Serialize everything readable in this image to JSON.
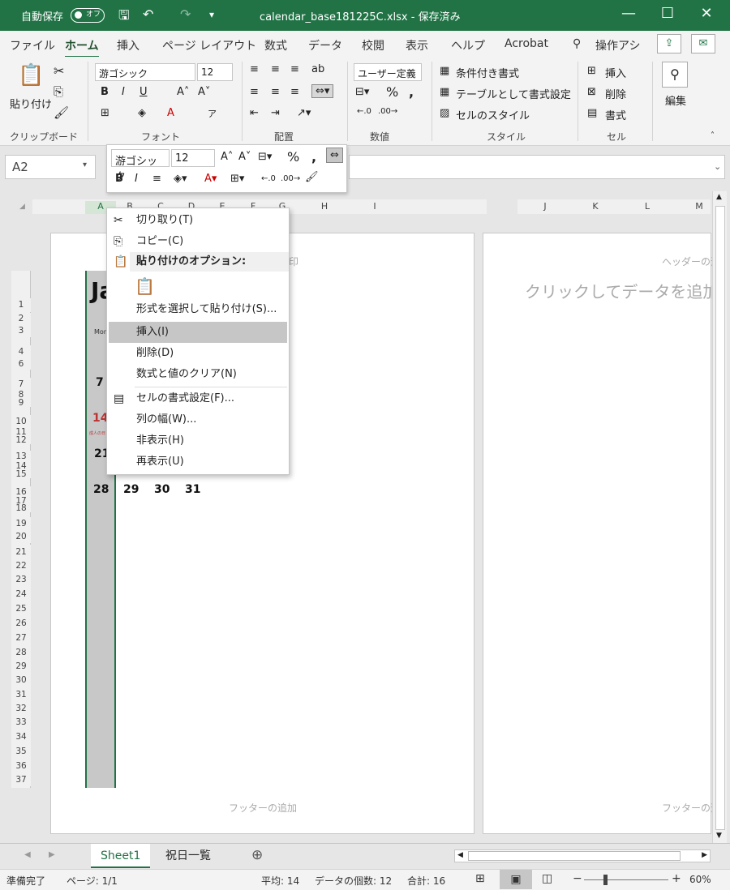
{
  "titlebar": {
    "autosave_label": "自動保存",
    "autosave_state": "オフ",
    "title": "calendar_base181225C.xlsx - 保存済み",
    "minimize": "—",
    "maximize": "☐",
    "close": "✕"
  },
  "tabs": [
    "ファイル",
    "ホーム",
    "挿入",
    "ページ レイアウト",
    "数式",
    "データ",
    "校閲",
    "表示",
    "ヘルプ",
    "Acrobat",
    "操作アシ"
  ],
  "ribbon": {
    "clipboard": {
      "paste": "貼り付け",
      "label": "クリップボード"
    },
    "font": {
      "name": "游ゴシック",
      "size": "12",
      "label": "フォント"
    },
    "alignment": {
      "label": "配置"
    },
    "number": {
      "format": "ユーザー定義",
      "label": "数値"
    },
    "styles": {
      "conditional": "条件付き書式",
      "table": "テーブルとして書式設定",
      "cell": "セルのスタイル",
      "label": "スタイル"
    },
    "cells": {
      "insert": "挿入",
      "delete": "削除",
      "format": "書式",
      "label": "セル"
    },
    "editing": {
      "label": "編集"
    }
  },
  "formula_bar": {
    "name_box": "A2"
  },
  "columns_left": [
    "A",
    "B",
    "C",
    "D",
    "E",
    "F",
    "G",
    "H",
    "I"
  ],
  "columns_right": [
    "J",
    "K",
    "L",
    "M"
  ],
  "rows": [
    "1",
    "2",
    "3",
    "4",
    "6",
    "7",
    "8",
    "9",
    "10",
    "11",
    "12",
    "13",
    "14",
    "15",
    "16",
    "17",
    "18",
    "19",
    "20",
    "21",
    "22",
    "23",
    "24",
    "25",
    "26",
    "27",
    "28",
    "29",
    "30",
    "31",
    "32",
    "33",
    "34",
    "35",
    "36",
    "37"
  ],
  "calendar": {
    "title_fragment": "Ja",
    "mon_label": "Mon",
    "days": [
      "7",
      "14",
      "21",
      "28",
      "29",
      "30",
      "31"
    ],
    "note": "成人の日"
  },
  "page": {
    "header_add": "ヘッダーの追加",
    "header_right": "ヘッダーの追",
    "click_add": "クリックしてデータを追加",
    "footer_add": "フッターの追加",
    "footer_right": "フッターの追"
  },
  "mini_toolbar": {
    "font": "游ゴシック",
    "size": "12"
  },
  "context_menu": {
    "cut": "切り取り(T)",
    "copy": "コピー(C)",
    "paste_options": "貼り付けのオプション:",
    "paste_special": "形式を選択して貼り付け(S)...",
    "insert": "挿入(I)",
    "delete": "削除(D)",
    "clear": "数式と値のクリア(N)",
    "format_cells": "セルの書式設定(F)...",
    "col_width": "列の幅(W)...",
    "hide": "非表示(H)",
    "unhide": "再表示(U)"
  },
  "sheet_tabs": {
    "sheet1": "Sheet1",
    "holidays": "祝日一覧"
  },
  "status": {
    "ready": "準備完了",
    "page": "ページ: 1/1",
    "average": "平均: 14",
    "count": "データの個数: 12",
    "sum": "合計: 16",
    "zoom": "60%"
  },
  "colors": {
    "accent": "#217346",
    "highlight": "#c6c6c6"
  }
}
